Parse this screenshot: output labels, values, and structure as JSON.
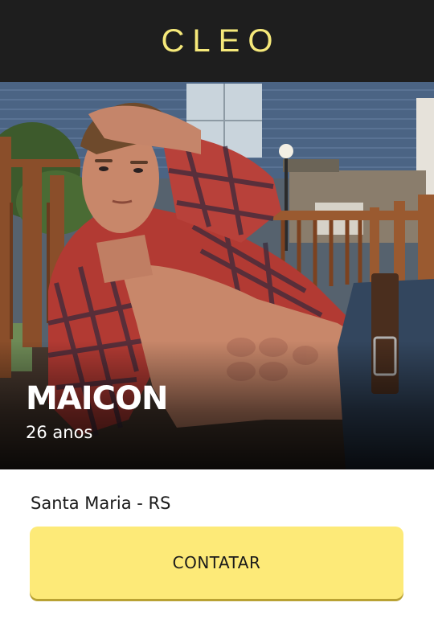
{
  "header": {
    "logo_text": "CLEO"
  },
  "profile": {
    "name": "MAICON",
    "age": "26 anos",
    "photo_icon": "profile-photo",
    "location": "Santa Maria - RS"
  },
  "actions": {
    "contact_label": "CONTATAR"
  },
  "colors": {
    "header_bg": "#1e1e1e",
    "logo": "#f6e97a",
    "button_bg": "#fdea78",
    "button_shadow": "#b9a233"
  }
}
